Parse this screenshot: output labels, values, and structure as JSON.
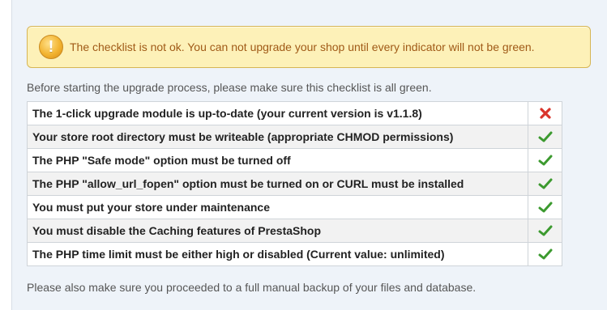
{
  "warning": {
    "icon": "exclamation-icon",
    "text": "The checklist is not ok. You can not upgrade your shop until every indicator will not be green."
  },
  "intro": "Before starting the upgrade process, please make sure this checklist is all green.",
  "checklist": [
    {
      "label": "The 1-click upgrade module is up-to-date (your current version is v1.1.8)",
      "status": "fail",
      "icon": "red-x-icon"
    },
    {
      "label": "Your store root directory must be writeable (appropriate CHMOD permissions)",
      "status": "ok",
      "icon": "green-check-icon"
    },
    {
      "label": "The PHP \"Safe mode\" option must be turned off",
      "status": "ok",
      "icon": "green-check-icon"
    },
    {
      "label": "The PHP \"allow_url_fopen\" option must be turned on or CURL must be installed",
      "status": "ok",
      "icon": "green-check-icon"
    },
    {
      "label": "You must put your store under maintenance",
      "status": "ok",
      "icon": "green-check-icon"
    },
    {
      "label": "You must disable the Caching features of PrestaShop",
      "status": "ok",
      "icon": "green-check-icon"
    },
    {
      "label": "The PHP time limit must be either high or disabled (Current value: unlimited)",
      "status": "ok",
      "icon": "green-check-icon"
    }
  ],
  "footer_note": "Please also make sure you proceeded to a full manual backup of your files and database.",
  "colors": {
    "warning_bg": "#fdf1b8",
    "warning_text": "#a05a17",
    "ok": "#3c9a2f",
    "fail": "#d9342b",
    "panel_bg": "#eef3f9"
  }
}
